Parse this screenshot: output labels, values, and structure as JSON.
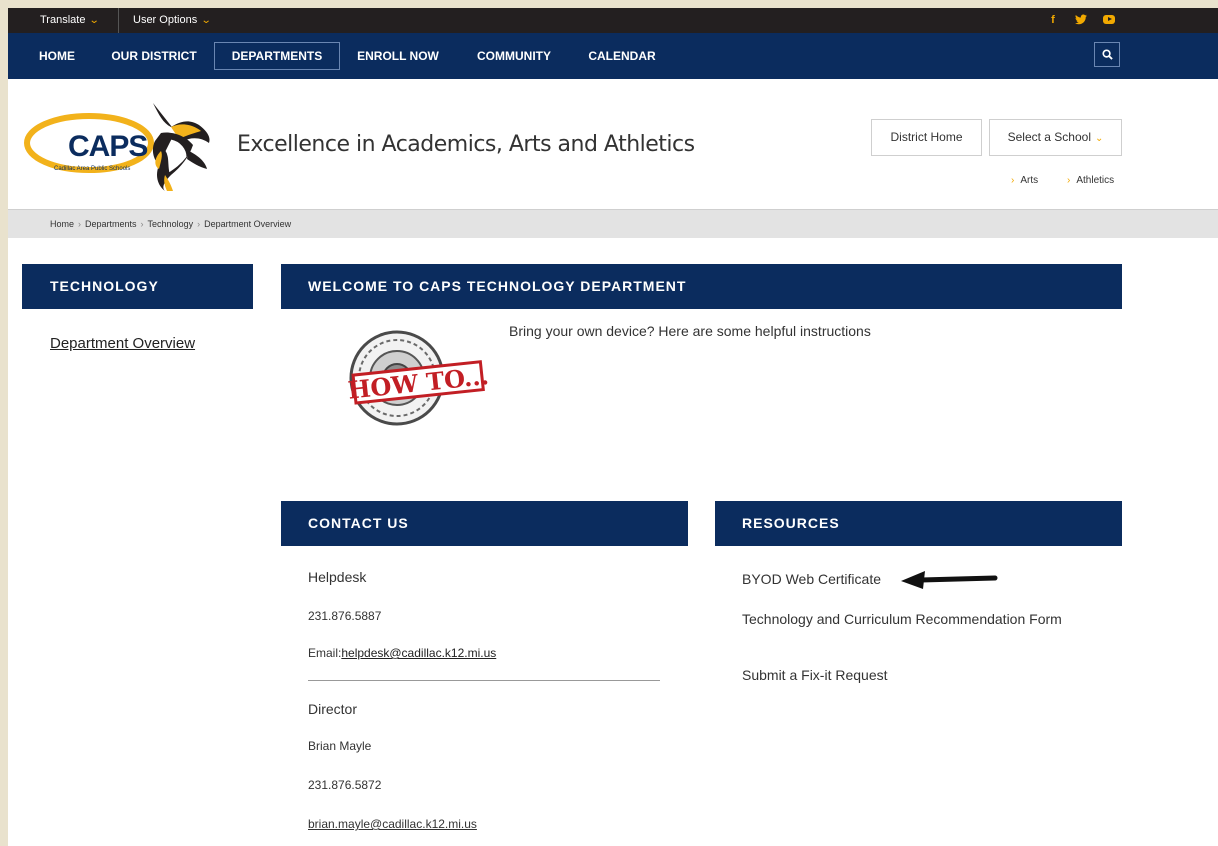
{
  "utility": {
    "translate": "Translate",
    "user_options": "User Options",
    "social": [
      "facebook-icon",
      "twitter-icon",
      "youtube-icon"
    ]
  },
  "nav": {
    "home": "HOME",
    "district": "OUR DISTRICT",
    "departments": "DEPARTMENTS",
    "enroll": "ENROLL NOW",
    "community": "COMMUNITY",
    "calendar": "CALENDAR"
  },
  "header": {
    "logo_text": "CAPS",
    "logo_subtext": "Cadillac Area Public Schools",
    "tagline": "Excellence in Academics, Arts and Athletics",
    "district_home": "District Home",
    "select_school": "Select a School",
    "quick_links": [
      "Arts",
      "Athletics"
    ]
  },
  "breadcrumb": [
    "Home",
    "Departments",
    "Technology",
    "Department Overview"
  ],
  "sidebar": {
    "heading": "TECHNOLOGY",
    "link": "Department Overview"
  },
  "welcome": {
    "heading": "WELCOME TO CAPS TECHNOLOGY DEPARTMENT",
    "text": "Bring your own device? Here are some helpful instructions",
    "image_text": "HOW TO..."
  },
  "contact": {
    "heading": "CONTACT US",
    "helpdesk": "Helpdesk",
    "helpdesk_phone": "231.876.5887",
    "email_label": "Email:",
    "helpdesk_email": "helpdesk@cadillac.k12.mi.us",
    "director_label": "Director",
    "director_name": "Brian Mayle",
    "director_phone": "231.876.5872",
    "director_email": "brian.mayle@cadillac.k12.mi.us"
  },
  "resources": {
    "heading": "RESOURCES",
    "links": [
      "BYOD Web Certificate",
      "Technology and Curriculum Recommendation Form",
      "Submit a Fix-it Request"
    ]
  },
  "colors": {
    "navy": "#0b2c5e",
    "gold": "#f2a900",
    "utility_bar": "#231f20"
  }
}
